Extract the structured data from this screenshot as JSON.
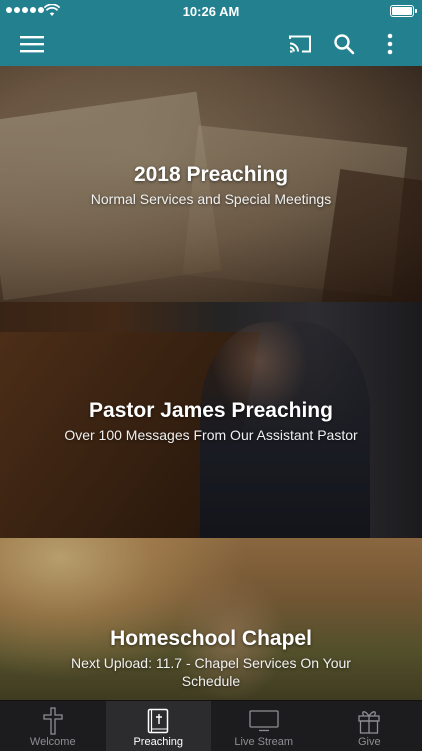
{
  "status_bar": {
    "time": "10:26 AM"
  },
  "app_bar": {
    "icons": [
      "menu-icon",
      "cast-icon",
      "search-icon",
      "more-vertical-icon"
    ]
  },
  "cards": [
    {
      "title": "2018 Preaching",
      "subtitle": "Normal Services and Special Meetings"
    },
    {
      "title": "Pastor James Preaching",
      "subtitle": "Over 100 Messages From Our Assistant Pastor"
    },
    {
      "title": "Homeschool Chapel",
      "subtitle": "Next Upload: 11.7 - Chapel Services On Your Schedule"
    }
  ],
  "tabs": [
    {
      "label": "Welcome",
      "icon": "cross-icon",
      "active": false
    },
    {
      "label": "Preaching",
      "icon": "bible-icon",
      "active": true
    },
    {
      "label": "Live Stream",
      "icon": "tv-icon",
      "active": false
    },
    {
      "label": "Give",
      "icon": "gift-icon",
      "active": false
    }
  ],
  "colors": {
    "accent": "#22808f",
    "tab_bar": "#1c1c1e",
    "tab_inactive": "#8e8e93",
    "tab_active": "#ffffff"
  }
}
